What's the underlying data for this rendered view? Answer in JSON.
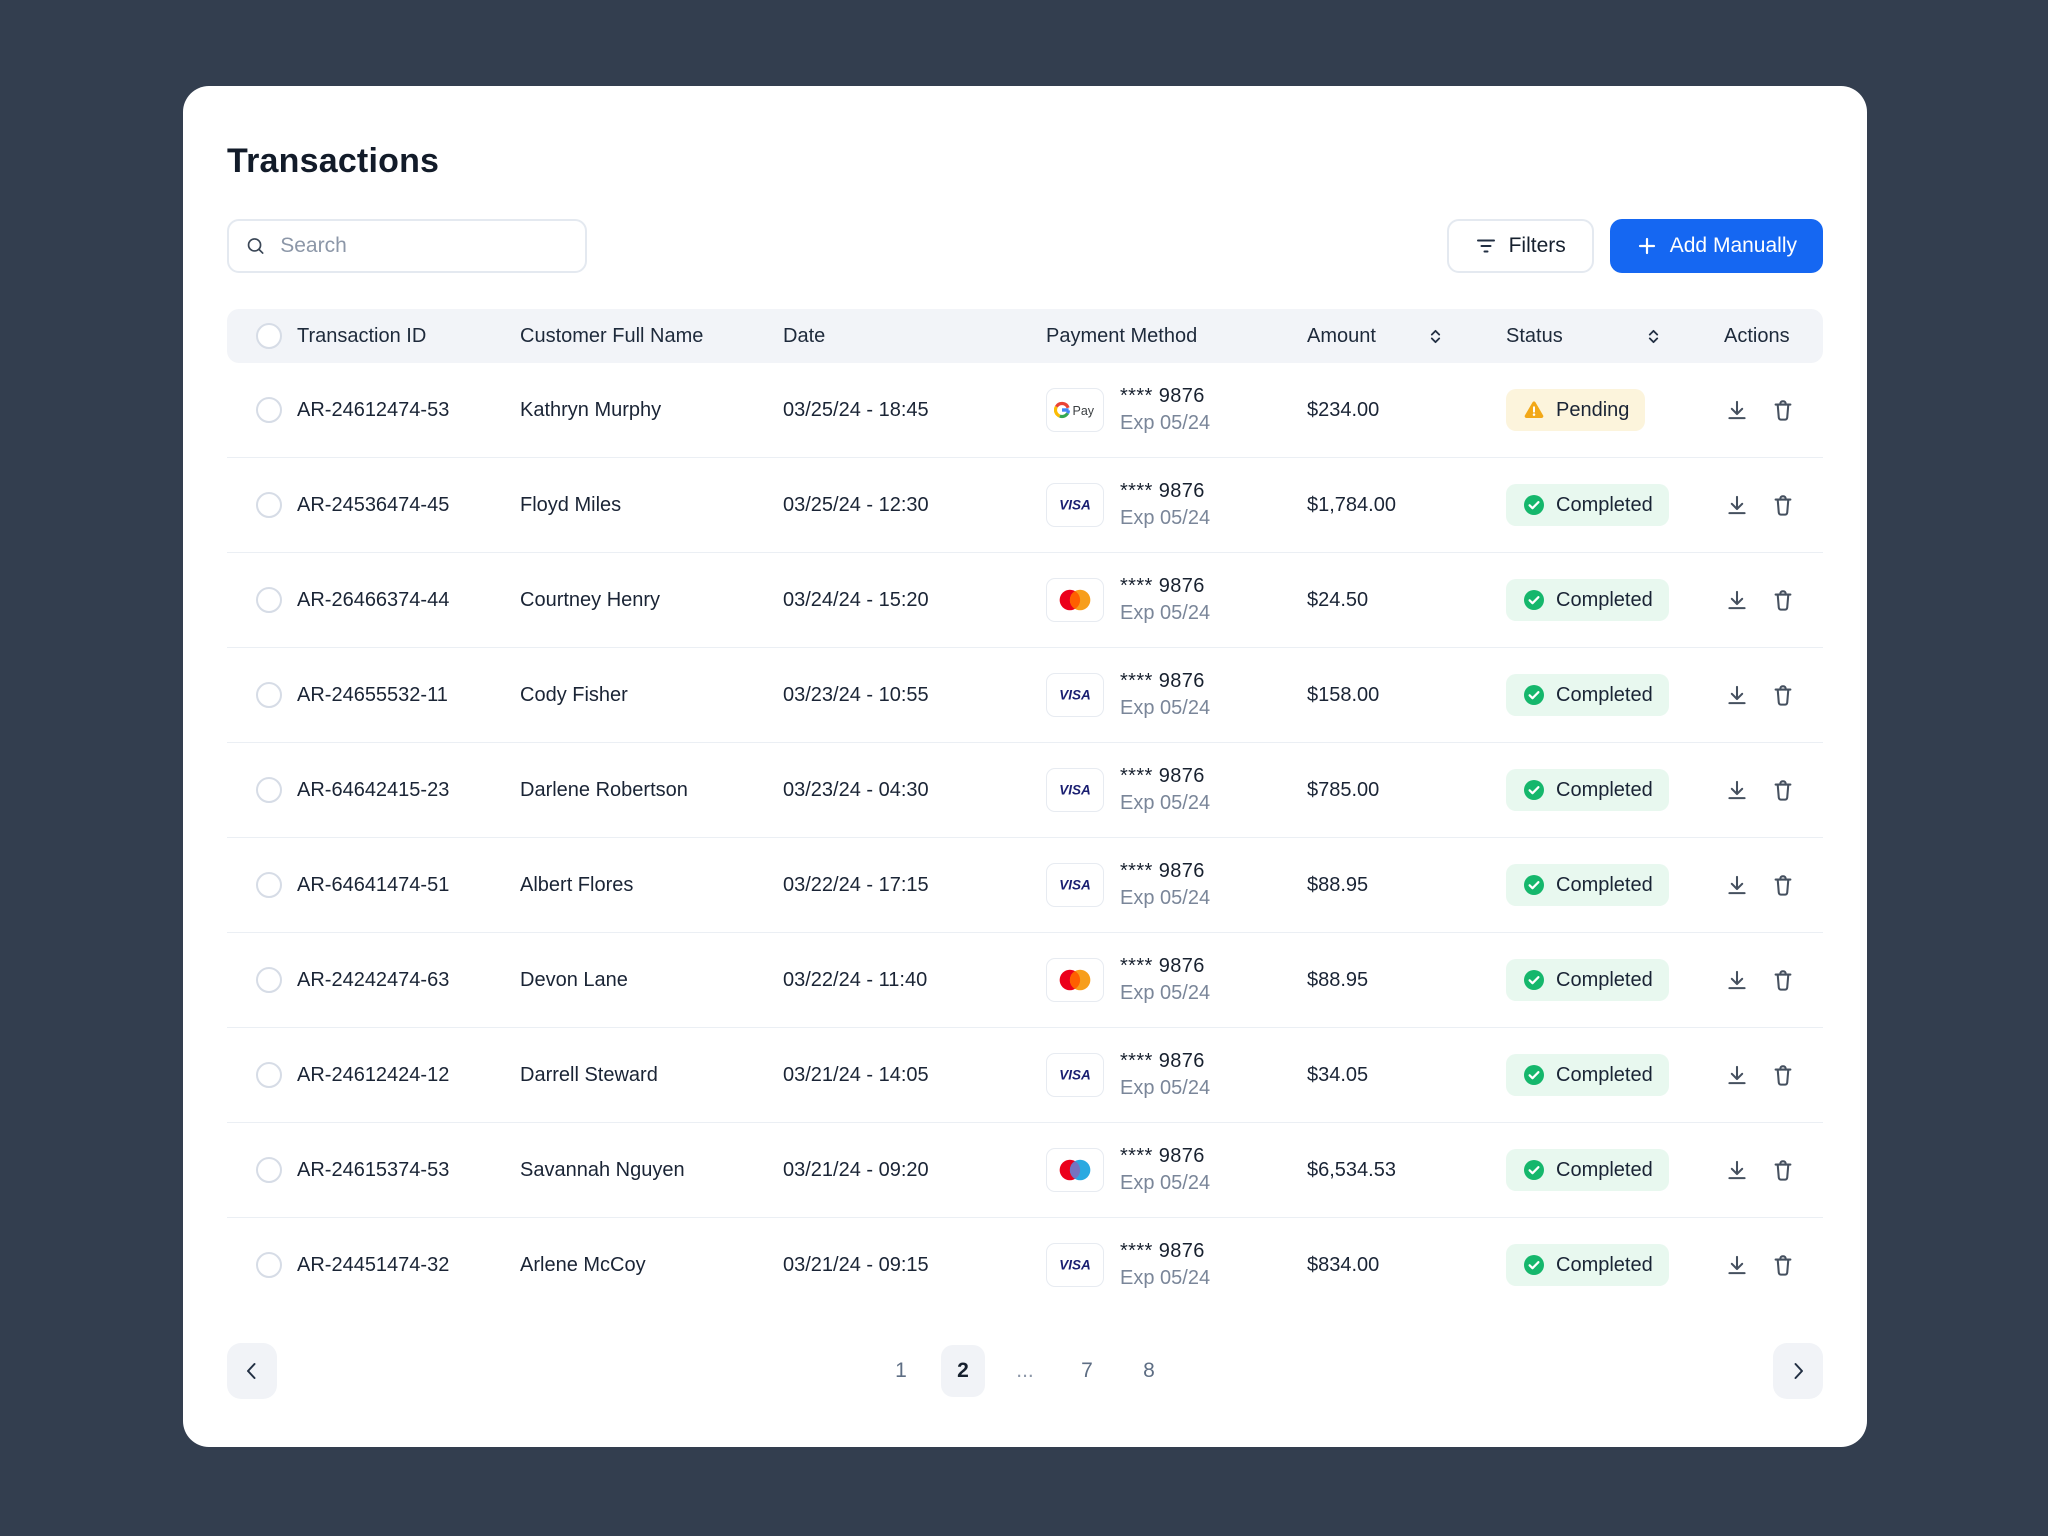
{
  "page": {
    "title": "Transactions",
    "background_color": "#333E4F",
    "panel_color": "#FFFFFF"
  },
  "search": {
    "placeholder": "Search"
  },
  "toolbar": {
    "filters_label": "Filters",
    "add_manually_label": "Add Manually",
    "accent_color": "#1567F2"
  },
  "table": {
    "columns": [
      "Transaction ID",
      "Customer Full Name",
      "Date",
      "Payment Method",
      "Amount",
      "Status",
      "Actions"
    ],
    "sortable_columns": [
      "Amount",
      "Status"
    ],
    "rows": [
      {
        "id": "AR-24612474-53",
        "customer": "Kathryn Murphy",
        "date": "03/25/24 - 18:45",
        "payment_brand": "gpay",
        "card": "**** 9876",
        "exp": "Exp 05/24",
        "amount": "$234.00",
        "status": "Pending"
      },
      {
        "id": "AR-24536474-45",
        "customer": "Floyd Miles",
        "date": "03/25/24 - 12:30",
        "payment_brand": "visa",
        "card": "**** 9876",
        "exp": "Exp 05/24",
        "amount": "$1,784.00",
        "status": "Completed"
      },
      {
        "id": "AR-26466374-44",
        "customer": "Courtney Henry",
        "date": "03/24/24 - 15:20",
        "payment_brand": "mastercard",
        "card": "**** 9876",
        "exp": "Exp 05/24",
        "amount": "$24.50",
        "status": "Completed"
      },
      {
        "id": "AR-24655532-11",
        "customer": "Cody Fisher",
        "date": "03/23/24 - 10:55",
        "payment_brand": "visa",
        "card": "**** 9876",
        "exp": "Exp 05/24",
        "amount": "$158.00",
        "status": "Completed"
      },
      {
        "id": "AR-64642415-23",
        "customer": "Darlene Robertson",
        "date": "03/23/24 - 04:30",
        "payment_brand": "visa",
        "card": "**** 9876",
        "exp": "Exp 05/24",
        "amount": "$785.00",
        "status": "Completed"
      },
      {
        "id": "AR-64641474-51",
        "customer": "Albert Flores",
        "date": "03/22/24 - 17:15",
        "payment_brand": "visa",
        "card": "**** 9876",
        "exp": "Exp 05/24",
        "amount": "$88.95",
        "status": "Completed"
      },
      {
        "id": "AR-24242474-63",
        "customer": "Devon Lane",
        "date": "03/22/24 - 11:40",
        "payment_brand": "mastercard",
        "card": "**** 9876",
        "exp": "Exp 05/24",
        "amount": "$88.95",
        "status": "Completed"
      },
      {
        "id": "AR-24612424-12",
        "customer": "Darrell Steward",
        "date": "03/21/24 - 14:05",
        "payment_brand": "visa",
        "card": "**** 9876",
        "exp": "Exp 05/24",
        "amount": "$34.05",
        "status": "Completed"
      },
      {
        "id": "AR-24615374-53",
        "customer": "Savannah Nguyen",
        "date": "03/21/24 - 09:20",
        "payment_brand": "maestro",
        "card": "**** 9876",
        "exp": "Exp 05/24",
        "amount": "$6,534.53",
        "status": "Completed"
      },
      {
        "id": "AR-24451474-32",
        "customer": "Arlene McCoy",
        "date": "03/21/24 - 09:15",
        "payment_brand": "visa",
        "card": "**** 9876",
        "exp": "Exp 05/24",
        "amount": "$834.00",
        "status": "Completed"
      }
    ]
  },
  "status_styles": {
    "Pending": {
      "badge_bg": "#FCF4DC",
      "icon": "warning-triangle",
      "icon_color": "#F2A818"
    },
    "Completed": {
      "badge_bg": "#E8F8EF",
      "icon": "check-circle",
      "icon_color": "#15B76C"
    }
  },
  "brand_colors": {
    "visa_blue": "#1A1F71",
    "mastercard": [
      "#EB001B",
      "#FF5F00",
      "#F79E1B"
    ],
    "maestro": [
      "#EB001B",
      "#7673C0",
      "#29A9E1"
    ],
    "gpay": [
      "#EA4335",
      "#FBBC05",
      "#34A853",
      "#4285F4"
    ]
  },
  "icons": [
    "search-icon",
    "filter-icon",
    "plus-icon",
    "sort-icon",
    "gpay-icon",
    "visa-icon",
    "mastercard-icon",
    "maestro-icon",
    "warning-icon",
    "check-circle-icon",
    "download-icon",
    "trash-icon",
    "chevron-left-icon",
    "chevron-right-icon"
  ],
  "pagination": {
    "pages": [
      "1",
      "2",
      "...",
      "7",
      "8"
    ],
    "active_page": "2"
  }
}
